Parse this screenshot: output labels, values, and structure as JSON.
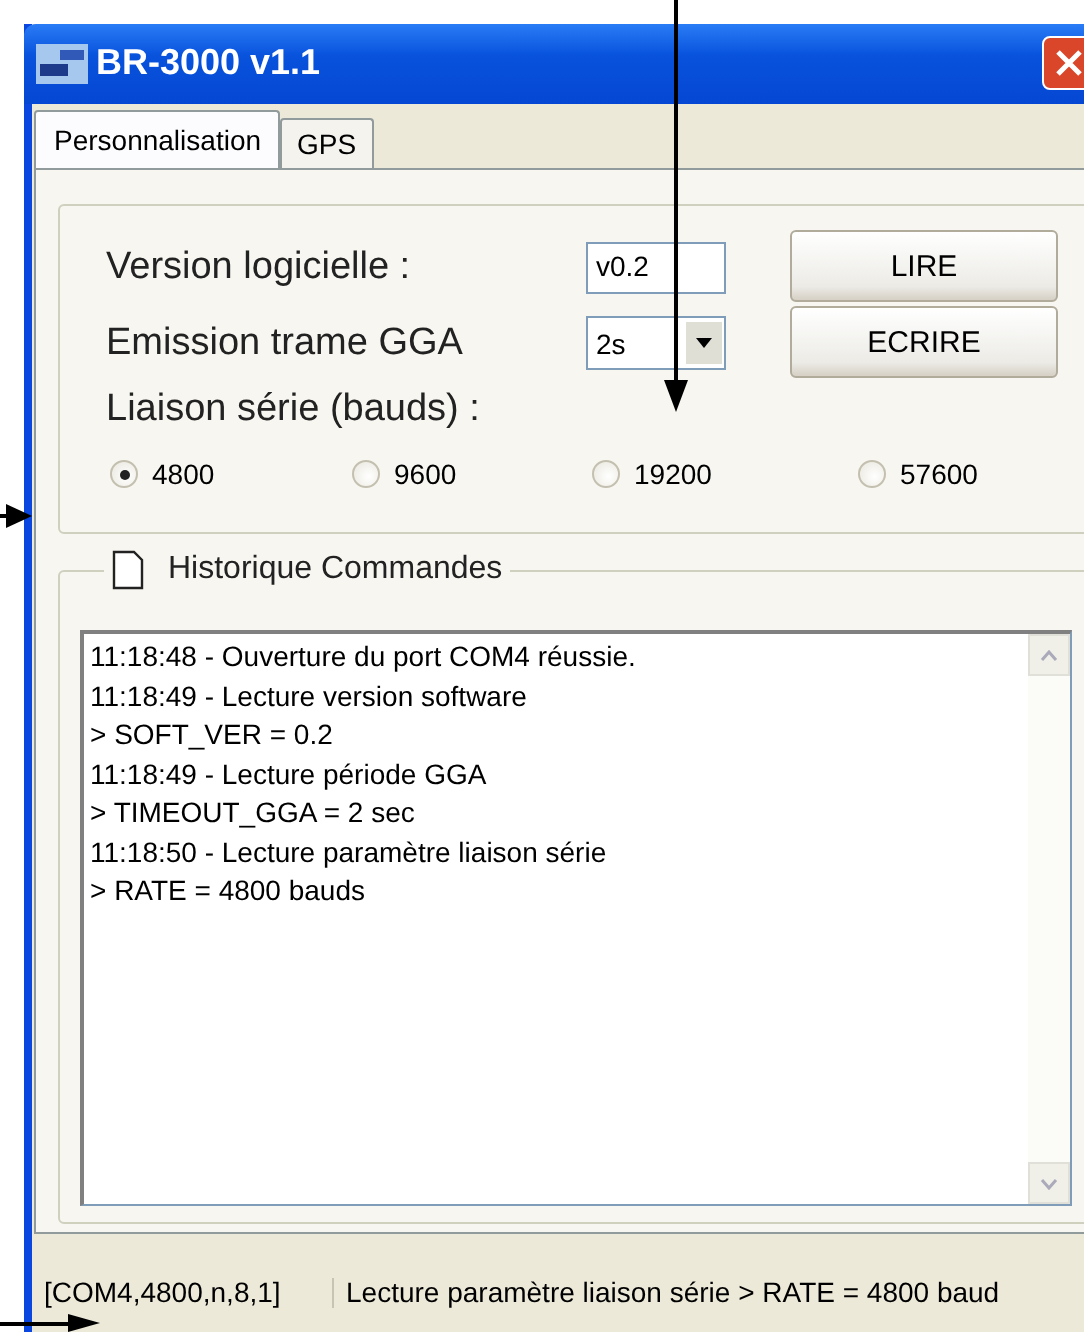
{
  "window": {
    "title": "BR-3000 v1.1"
  },
  "tabs": [
    {
      "label": "Personnalisation",
      "selected": true
    },
    {
      "label": "GPS",
      "selected": false
    }
  ],
  "settings": {
    "version_label": "Version logicielle :",
    "version_value": "v0.2",
    "gga_label": "Emission trame GGA",
    "gga_value": "2s",
    "serial_label": "Liaison série (bauds) :",
    "baud_options": [
      {
        "label": "4800",
        "selected": true
      },
      {
        "label": "9600",
        "selected": false
      },
      {
        "label": "19200",
        "selected": false
      },
      {
        "label": "57600",
        "selected": false
      }
    ],
    "buttons": [
      "LIRE",
      "ECRIRE"
    ]
  },
  "history": {
    "title": "Historique Commandes",
    "lines": [
      "11:18:48 - Ouverture du port COM4 réussie.",
      "11:18:49 - Lecture version software",
      "> SOFT_VER = 0.2",
      "11:18:49 - Lecture période GGA",
      "> TIMEOUT_GGA = 2 sec",
      "11:18:50 - Lecture paramètre liaison série",
      "> RATE = 4800 bauds"
    ]
  },
  "status_bar": [
    "[COM4,4800,n,8,1]",
    "Lecture paramètre liaison série > RATE = 4800 baud"
  ]
}
